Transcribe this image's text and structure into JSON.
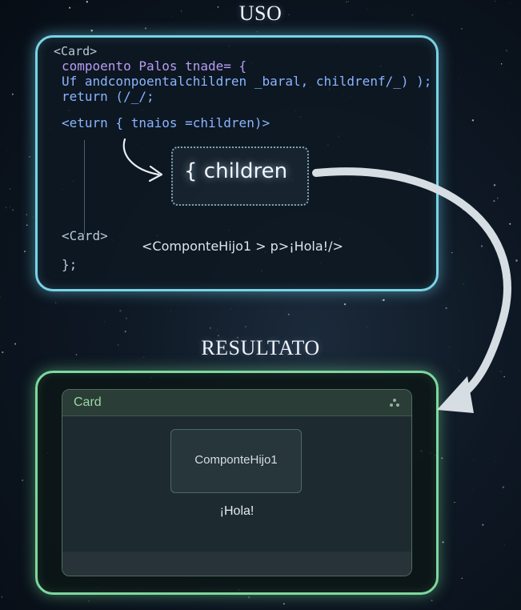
{
  "uso": {
    "title": "USO",
    "code_lines": [
      "<Card>",
      "compoento Palos tnade= {",
      "Uf andconpoentalchildren _baral, childrenf/_) );",
      "return (/_/;",
      "<eturn { tnaios =children)>",
      "<Card>",
      "};"
    ],
    "children_label": "{ children",
    "child_usage": "<ComponteHijo1 > p>¡Hola!/>"
  },
  "resultado": {
    "title": "RESULTATO",
    "card_title": "Card",
    "child_label": "ComponteHijo1",
    "hola": "¡Hola!"
  },
  "colors": {
    "uso_border": "#79d3e6",
    "resultado_border": "#7dd89e",
    "arrow": "#d6dde3"
  }
}
